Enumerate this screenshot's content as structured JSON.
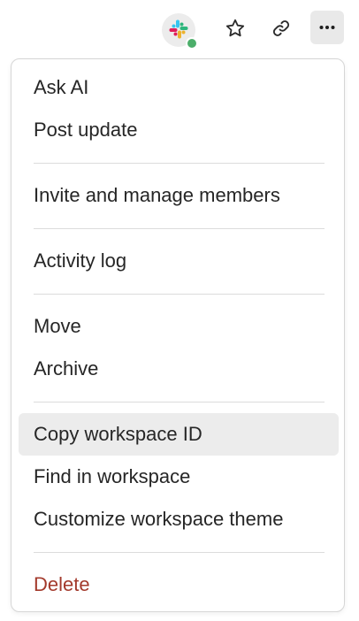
{
  "toolbar": {
    "integration_icon": "slack-icon",
    "integration_status_color": "#4cae6a",
    "favorite_icon": "star-icon",
    "link_icon": "link-icon",
    "more_icon": "more-horizontal-icon"
  },
  "menu": {
    "items": [
      {
        "label": "Ask AI"
      },
      {
        "label": "Post update"
      },
      {
        "label": "Invite and manage members"
      },
      {
        "label": "Activity log"
      },
      {
        "label": "Move"
      },
      {
        "label": "Archive"
      },
      {
        "label": "Copy workspace ID",
        "highlighted": true
      },
      {
        "label": "Find in workspace"
      },
      {
        "label": "Customize workspace theme"
      },
      {
        "label": "Delete",
        "danger": true,
        "color": "#a33a2c"
      }
    ]
  }
}
